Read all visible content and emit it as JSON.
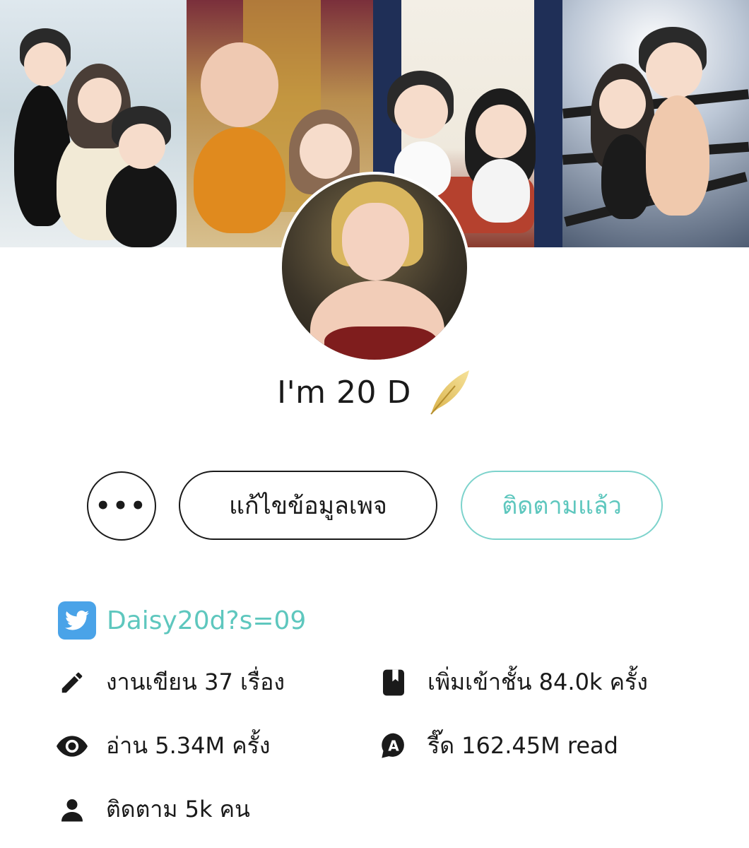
{
  "profile": {
    "name": "I'm 20 D",
    "badge_icon": "gold-feather-icon"
  },
  "actions": {
    "more_label": "•••",
    "edit_label": "แก้ไขข้อมูลเพจ",
    "follow_label": "ติดตามแล้ว"
  },
  "social": {
    "twitter_icon": "twitter-icon",
    "twitter_handle": "Daisy20d?s=09"
  },
  "stats": {
    "works": "งานเขียน 37 เรื่อง",
    "shelf": "เพิ่มเข้าชั้น 84.0k ครั้ง",
    "reads": "อ่าน 5.34M ครั้ง",
    "reads_alt": "รี๊ด 162.45M read",
    "followers": "ติดตาม 5k คน"
  },
  "colors": {
    "accent_teal": "#5ec7be",
    "twitter_blue": "#4aa3e8",
    "text": "#1a1a1a"
  }
}
